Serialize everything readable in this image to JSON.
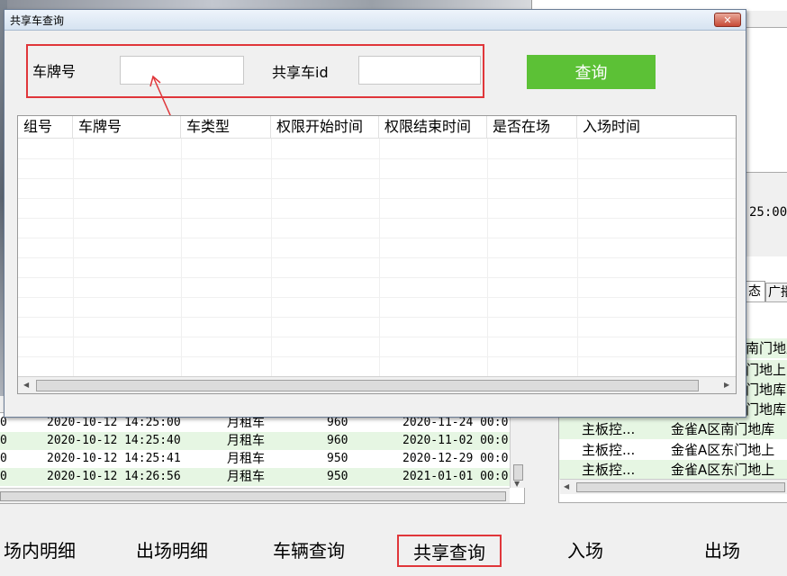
{
  "background": {
    "time_fragment": "25:00",
    "tabs": [
      "态",
      "广播"
    ],
    "right_list": [
      {
        "c1": "",
        "c2": "南门地上",
        "green": true
      },
      {
        "c1": "",
        "c2": "门地上",
        "green": true
      },
      {
        "c1": "",
        "c2": "门地库",
        "green": true
      },
      {
        "c1": "",
        "c2": "门地库",
        "green": true
      },
      {
        "c1": "主板控...",
        "c2": "金雀A区南门地库",
        "green": true
      },
      {
        "c1": "主板控...",
        "c2": "金雀A区东门地上",
        "green": false
      },
      {
        "c1": "主板控...",
        "c2": "金雀A区东门地上",
        "green": true
      }
    ],
    "left_list": [
      {
        "c0": "0",
        "time": "2020-10-12 14:25:00",
        "type": "月租车",
        "fee": "960",
        "end": "2020-11-24 00:0",
        "green": false
      },
      {
        "c0": "0",
        "time": "2020-10-12 14:25:40",
        "type": "月租车",
        "fee": "960",
        "end": "2020-11-02 00:0",
        "green": true
      },
      {
        "c0": "0",
        "time": "2020-10-12 14:25:41",
        "type": "月租车",
        "fee": "950",
        "end": "2020-12-29 00:0",
        "green": false
      },
      {
        "c0": "0",
        "time": "2020-10-12 14:26:56",
        "type": "月租车",
        "fee": "950",
        "end": "2021-01-01 00:0",
        "green": true
      }
    ]
  },
  "bottom_nav": {
    "in_lot_detail": "场内明细",
    "exit_detail": "出场明细",
    "vehicle_query": "车辆查询",
    "share_query": "共享查询",
    "entry": "入场",
    "exit": "出场"
  },
  "dialog": {
    "title": "共享车查询",
    "close_icon": "close-x",
    "close_glyph": "✕",
    "plate_label": "车牌号",
    "plate_value": "",
    "share_id_label": "共享车id",
    "share_id_value": "",
    "query_button": "查询",
    "columns": [
      "组号",
      "车牌号",
      "车类型",
      "权限开始时间",
      "权限结束时间",
      "是否在场",
      "入场时间"
    ],
    "rows": []
  },
  "colors": {
    "accent_green": "#5cc136",
    "highlight_red": "#e0363a",
    "row_green": "#e6f6e3"
  }
}
